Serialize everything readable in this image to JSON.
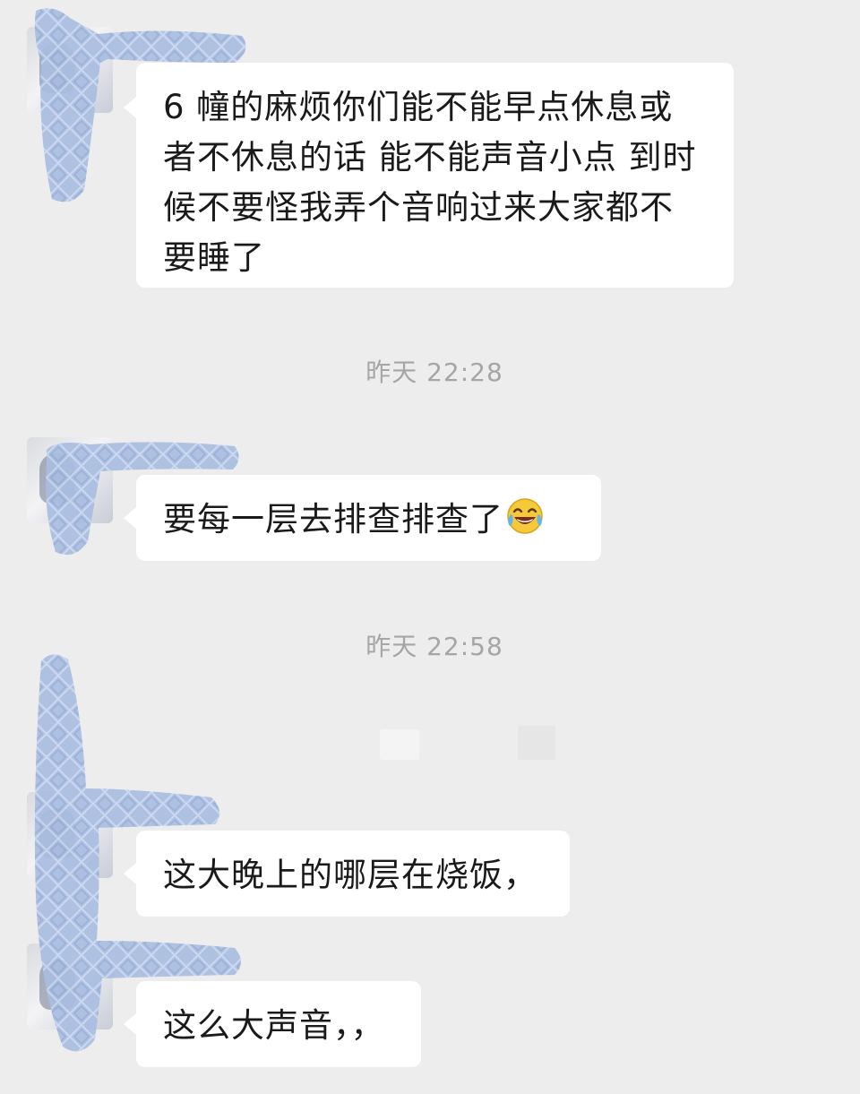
{
  "messages": [
    {
      "text": "6 幢的麻烦你们能不能早点休息或者不休息的话 能不能声音小点 到时候不要怪我弄个音响过来大家都不要睡了"
    },
    {
      "text": "要每一层去排查排查了",
      "emoji": "laughing-tears"
    },
    {
      "text": "这大晚上的哪层在烧饭，"
    },
    {
      "text": "这么大声音，，"
    }
  ],
  "timestamps": [
    "昨天 22:28",
    "昨天 22:58"
  ],
  "redaction_color": "#a9bde0",
  "bubble_color": "#ffffff",
  "background_color": "#ededed"
}
